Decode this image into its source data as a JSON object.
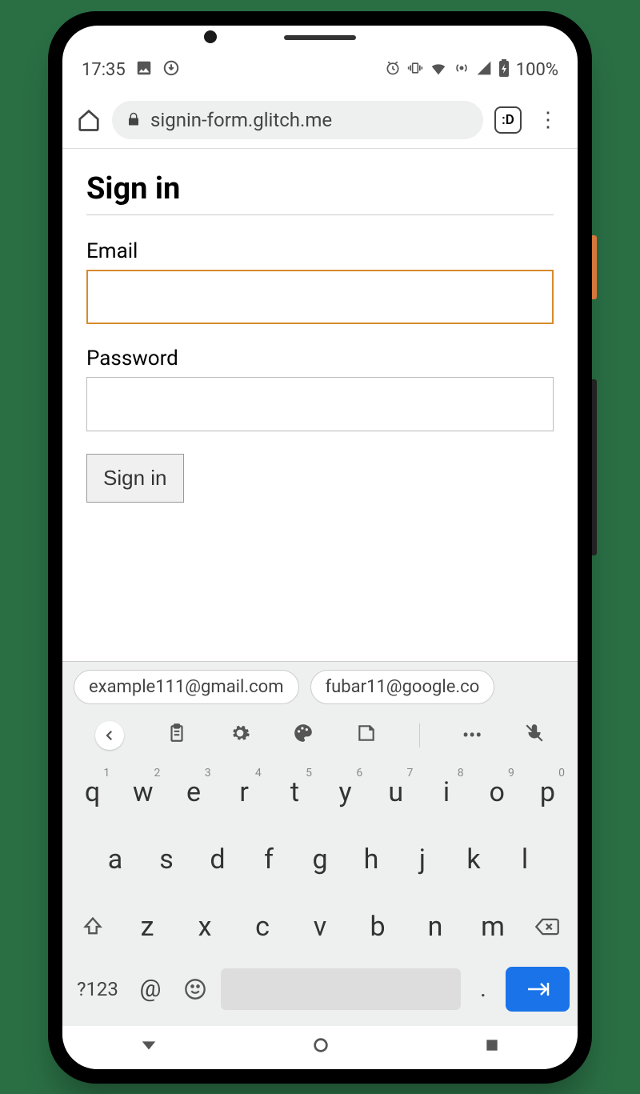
{
  "statusBar": {
    "time": "17:35",
    "batteryText": "100%"
  },
  "browser": {
    "url": "signin-form.glitch.me",
    "tabCount": ":D"
  },
  "page": {
    "title": "Sign in",
    "emailLabel": "Email",
    "passwordLabel": "Password",
    "signinButton": "Sign in"
  },
  "suggestions": {
    "item1": "example111@gmail.com",
    "item2": "fubar11@google.co"
  },
  "keyboard": {
    "row1": [
      "q",
      "w",
      "e",
      "r",
      "t",
      "y",
      "u",
      "i",
      "o",
      "p"
    ],
    "row1sup": [
      "1",
      "2",
      "3",
      "4",
      "5",
      "6",
      "7",
      "8",
      "9",
      "0"
    ],
    "row2": [
      "a",
      "s",
      "d",
      "f",
      "g",
      "h",
      "j",
      "k",
      "l"
    ],
    "row3": [
      "z",
      "x",
      "c",
      "v",
      "b",
      "n",
      "m"
    ],
    "symKey": "?123",
    "atKey": "@",
    "periodKey": "."
  }
}
